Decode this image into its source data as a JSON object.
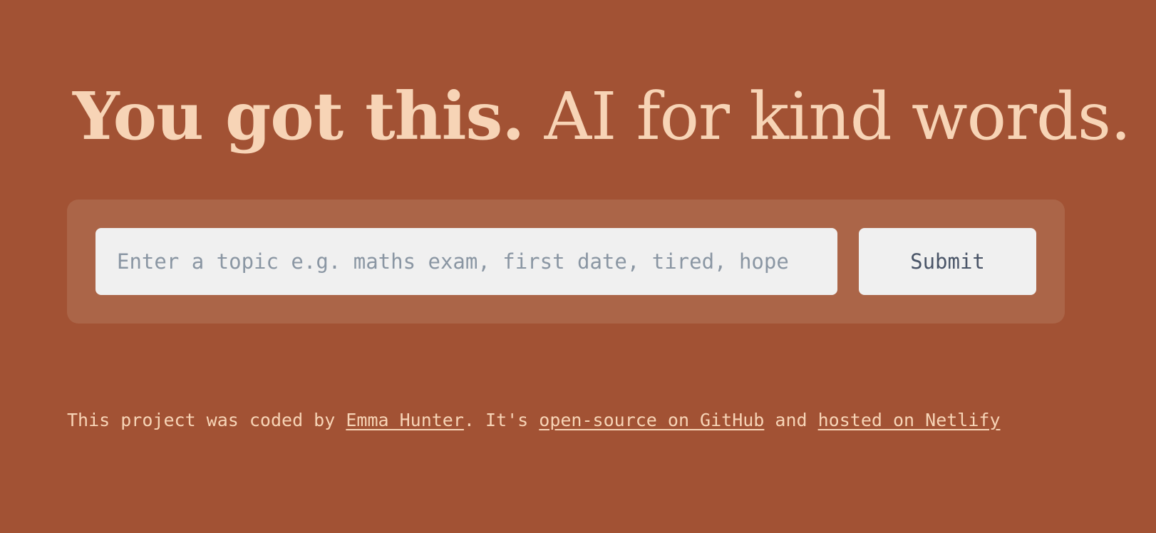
{
  "headline": {
    "strong_text": "You got this.",
    "light_text": " AI for kind words."
  },
  "search": {
    "placeholder": "Enter a topic e.g. maths exam, first date, tired, hope",
    "value": "",
    "submit_label": "Submit"
  },
  "footer": {
    "text_1": "This project was coded by ",
    "author_link": "Emma Hunter",
    "text_2": ". It's ",
    "github_link": "open-source on GitHub",
    "text_3": " and ",
    "netlify_link": "hosted on Netlify"
  },
  "colors": {
    "background": "#a25234",
    "panel": "#ab6548",
    "accent_text": "#f7d4b6",
    "input_bg": "#f0f0f0",
    "input_text": "#4a5568"
  }
}
